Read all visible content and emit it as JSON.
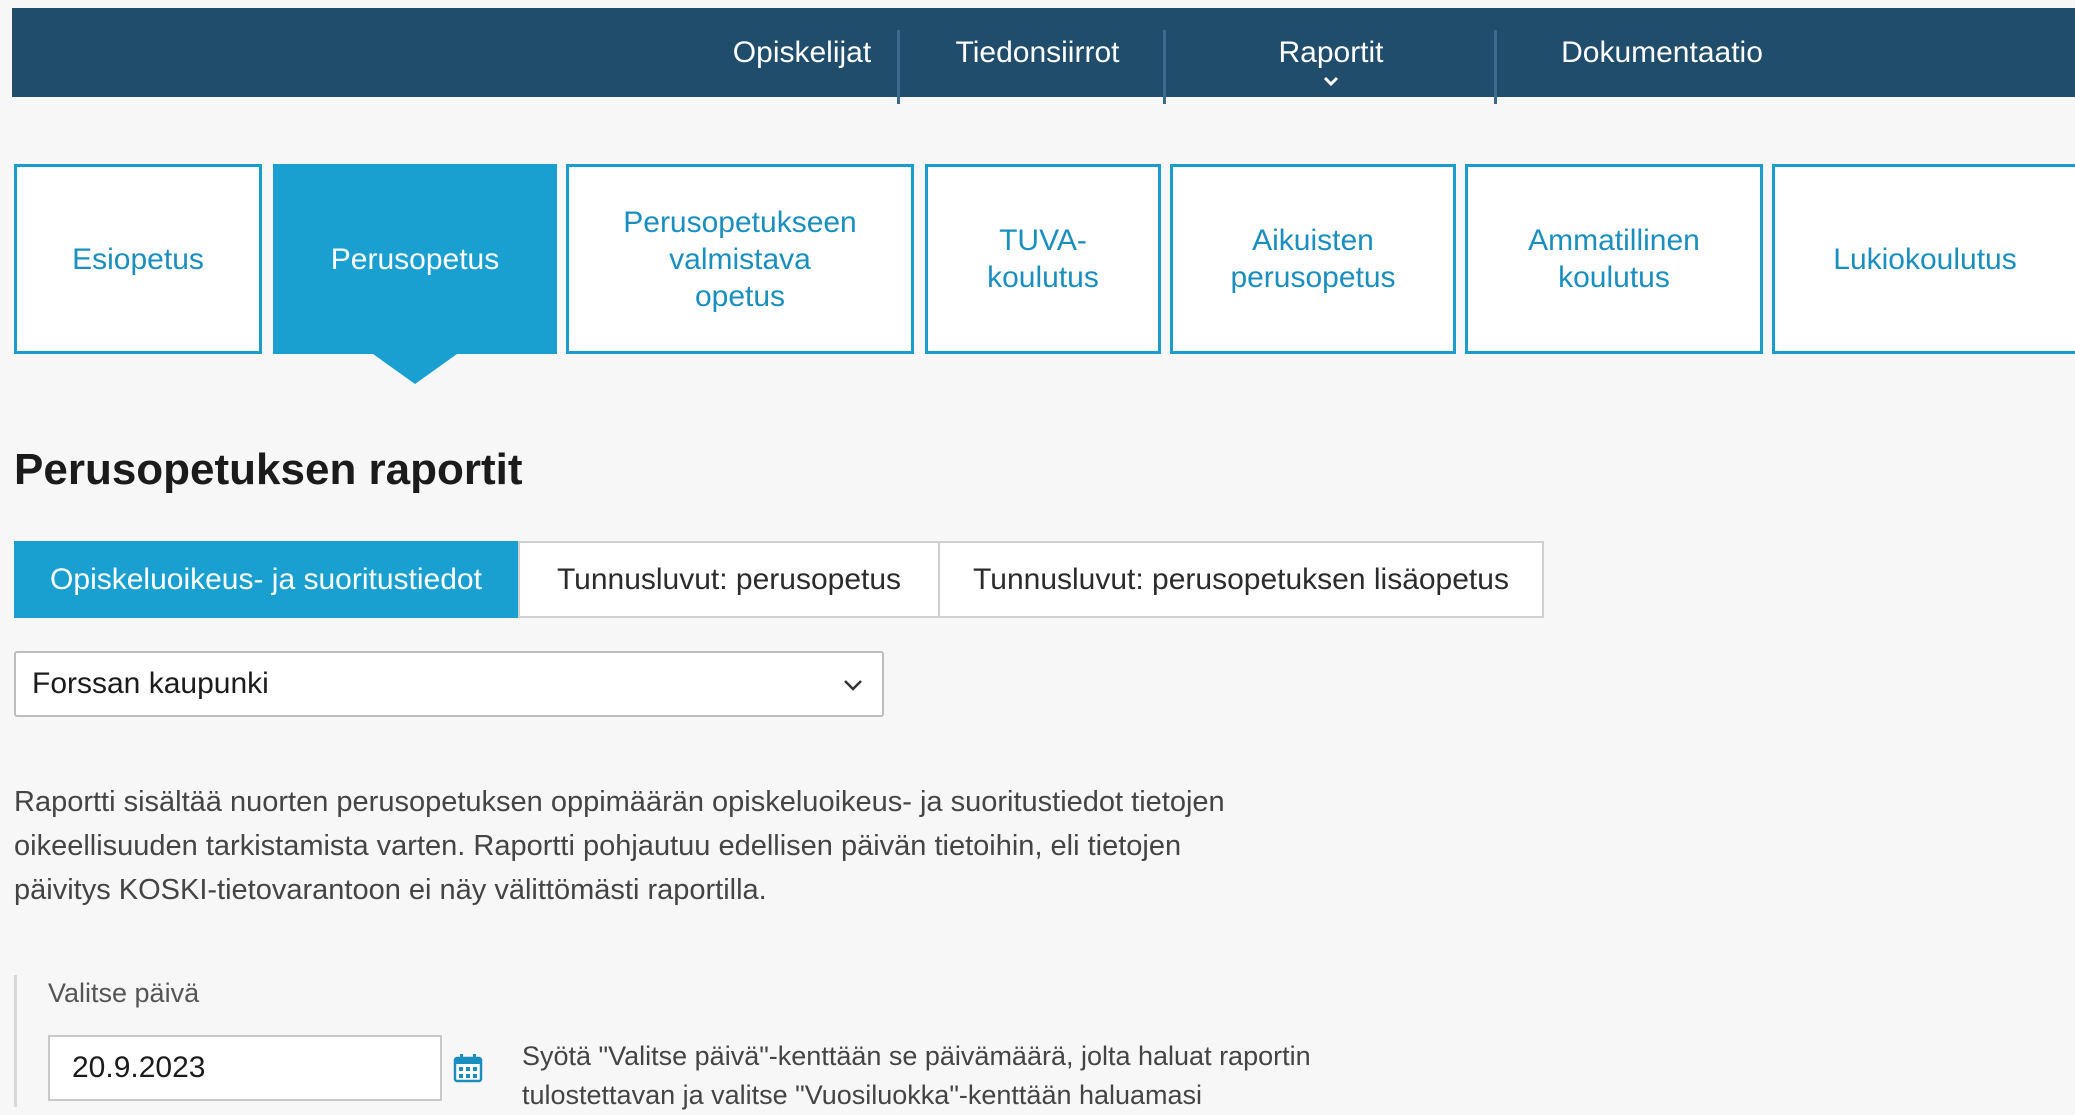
{
  "nav": {
    "items": [
      "Opiskelijat",
      "Tiedonsiirrot",
      "Raportit",
      "Dokumentaatio"
    ]
  },
  "tiles": [
    {
      "lines": [
        "Esiopetus"
      ]
    },
    {
      "lines": [
        "Perusopetus"
      ]
    },
    {
      "lines": [
        "Perusopetukseen",
        "valmistava",
        "opetus"
      ]
    },
    {
      "lines": [
        "TUVA-",
        "koulutus"
      ]
    },
    {
      "lines": [
        "Aikuisten",
        "perusopetus"
      ]
    },
    {
      "lines": [
        "Ammatillinen",
        "koulutus"
      ]
    },
    {
      "lines": [
        "Lukiokoulutus"
      ]
    }
  ],
  "page_title": "Perusopetuksen raportit",
  "report_tabs": [
    "Opiskeluoikeus- ja suoritustiedot",
    "Tunnusluvut: perusopetus",
    "Tunnusluvut: perusopetuksen lisäopetus"
  ],
  "organization_select": {
    "value": "Forssan kaupunki"
  },
  "description": [
    "Raportti sisältää nuorten perusopetuksen oppimäärän opiskeluoikeus- ja suoritustiedot tietojen",
    "oikeellisuuden tarkistamista varten. Raportti pohjautuu edellisen päivän tietoihin, eli tietojen",
    "päivitys KOSKI-tietovarantoon ei näy välittömästi raportilla."
  ],
  "date": {
    "label": "Valitse päivä",
    "value": "20.9.2023",
    "help": [
      "Syötä \"Valitse päivä\"-kenttään se päivämäärä, jolta haluat raportin",
      "tulostettavan ja valitse \"Vuosiluokka\"-kenttään haluamasi"
    ]
  },
  "colors": {
    "topbar": "#1f4d6b",
    "accent": "#1aa0d0"
  },
  "icons": [
    "chevron-down-icon",
    "calendar-icon"
  ]
}
